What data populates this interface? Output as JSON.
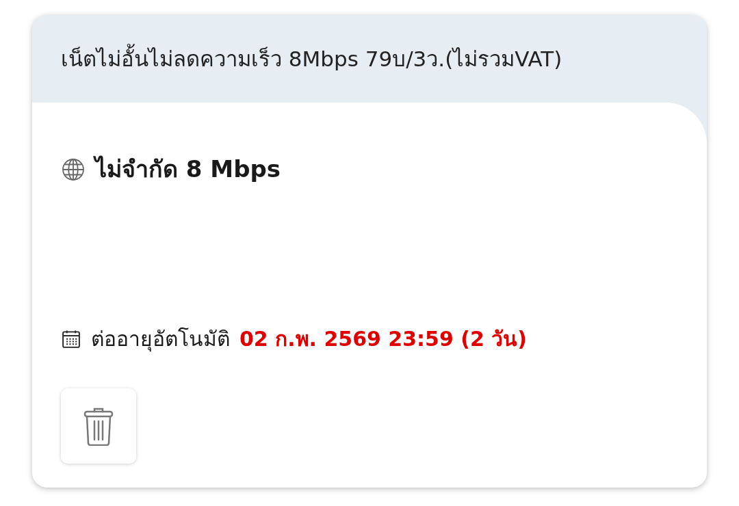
{
  "package": {
    "title": "เน็ตไม่อั้นไม่ลดความเร็ว 8Mbps 79บ/3ว.(ไม่รวมVAT)",
    "quota": "ไม่จำกัด 8 Mbps",
    "renewal": {
      "label": "ต่ออายุอัตโนมัติ",
      "date": "02 ก.พ. 2569 23:59 (2 วัน)"
    },
    "actions": [
      {
        "kind": "delete"
      }
    ]
  }
}
